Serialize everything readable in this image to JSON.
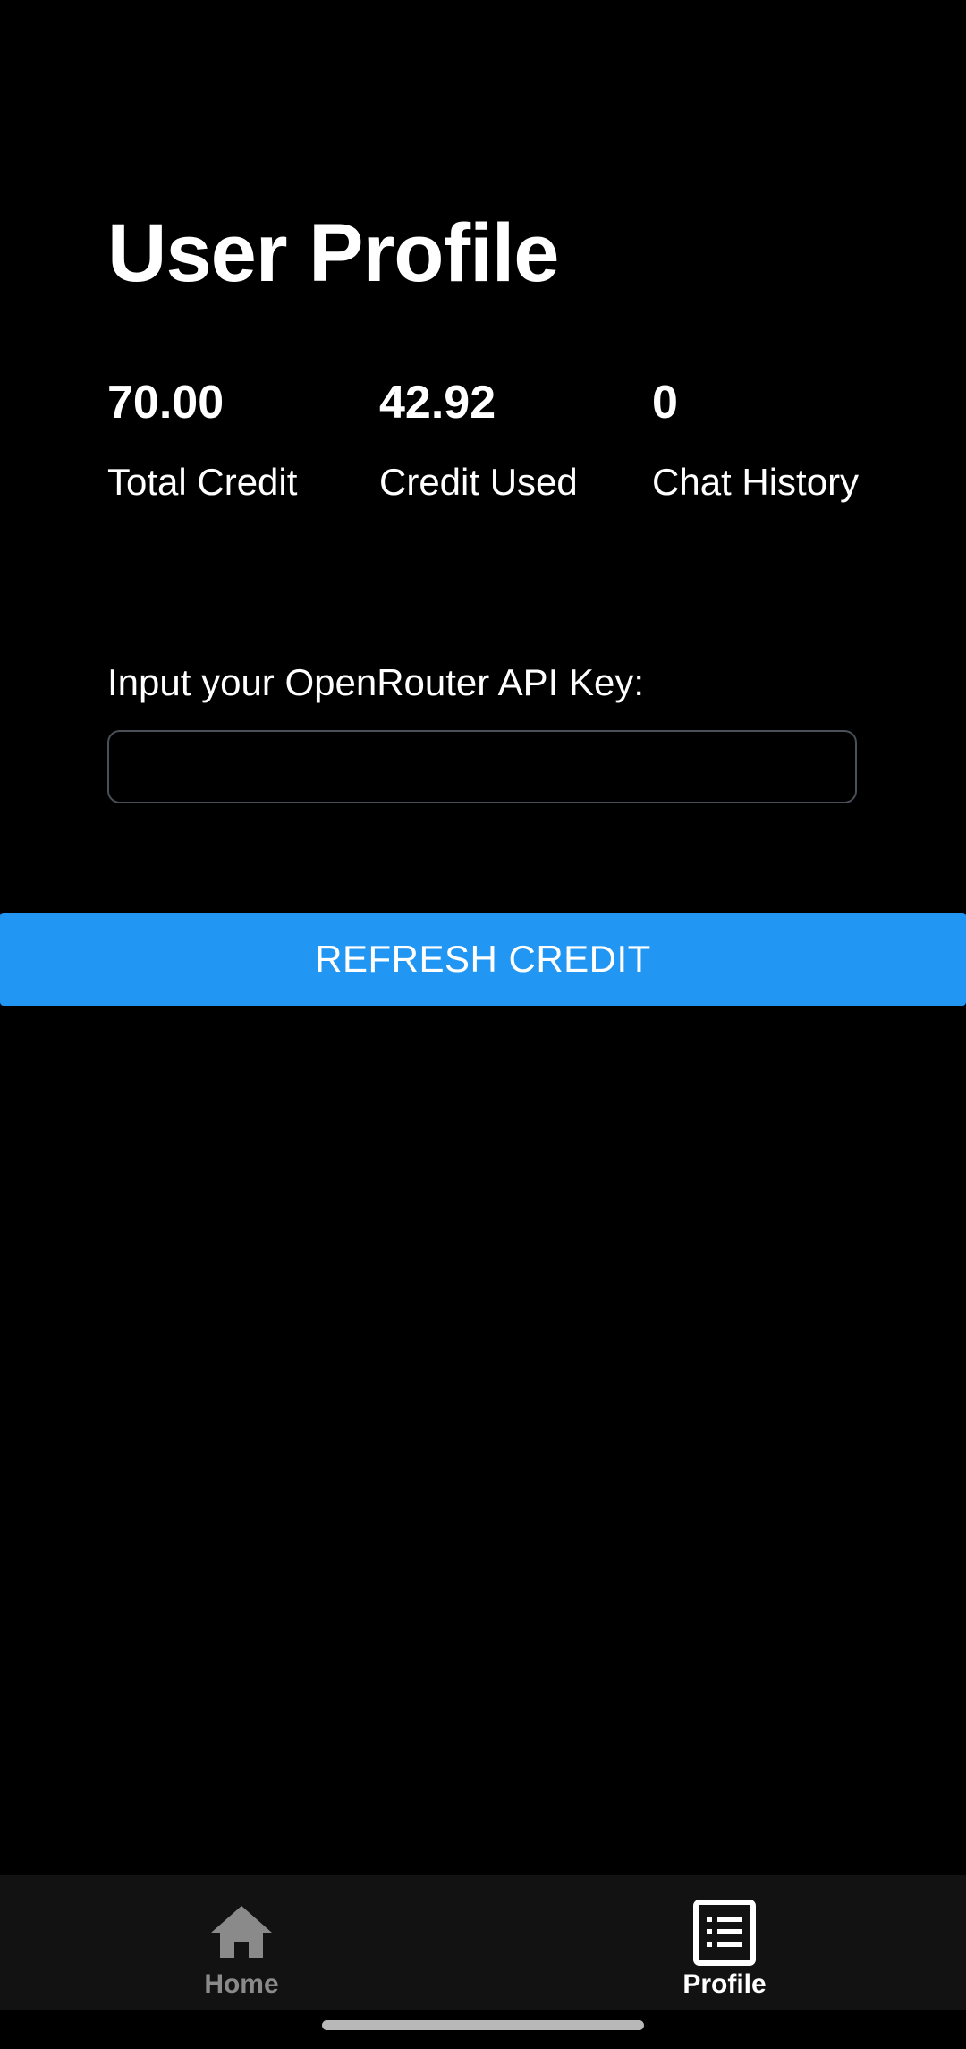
{
  "header": {
    "title": "User Profile"
  },
  "stats": [
    {
      "value": "70.00",
      "label": "Total Credit"
    },
    {
      "value": "42.92",
      "label": "Credit Used"
    },
    {
      "value": "0",
      "label": "Chat History"
    }
  ],
  "api_key": {
    "label": "Input your OpenRouter API Key:",
    "value": "",
    "placeholder": ""
  },
  "refresh_button": {
    "label": "REFRESH CREDIT",
    "color": "#2196f3"
  },
  "bottom_nav": {
    "items": [
      {
        "label": "Home",
        "icon": "home-icon",
        "active": false
      },
      {
        "label": "Profile",
        "icon": "list-icon",
        "active": true
      }
    ]
  }
}
